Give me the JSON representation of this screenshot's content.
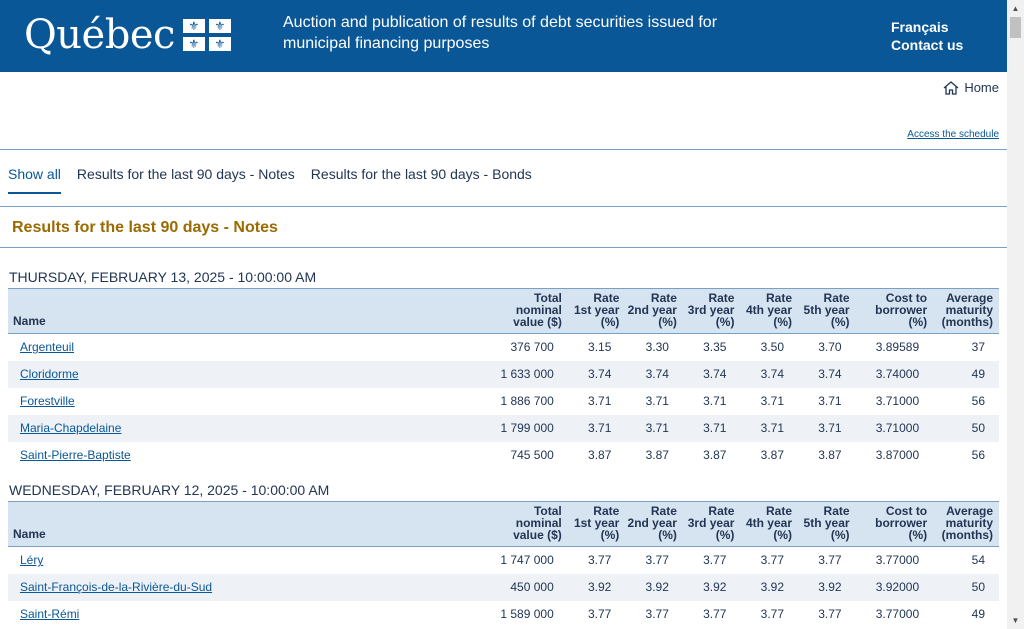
{
  "header": {
    "logo_text": "Québec",
    "title": "Auction and publication of results of debt securities issued for municipal financing purposes",
    "lang_link": "Français",
    "contact_link": "Contact us"
  },
  "nav": {
    "home_label": "Home",
    "schedule_link": "Access the schedule"
  },
  "tabs": [
    {
      "label": "Show all",
      "active": true
    },
    {
      "label": "Results for the last 90 days - Notes",
      "active": false
    },
    {
      "label": "Results for the last 90 days - Bonds",
      "active": false
    }
  ],
  "section_title": "Results for the last 90 days - Notes",
  "columns": {
    "name": "Name",
    "total": [
      "Total",
      "nominal",
      "value ($)"
    ],
    "rate1": [
      "Rate",
      "1st year",
      "(%)"
    ],
    "rate2": [
      "Rate",
      "2nd year",
      "(%)"
    ],
    "rate3": [
      "Rate",
      "3rd year",
      "(%)"
    ],
    "rate4": [
      "Rate",
      "4th year",
      "(%)"
    ],
    "rate5": [
      "Rate",
      "5th year",
      "(%)"
    ],
    "cost": [
      "Cost to",
      "borrower",
      "(%)"
    ],
    "maturity": [
      "Average",
      "maturity",
      "(months)"
    ]
  },
  "auctions": [
    {
      "date": "THURSDAY, FEBRUARY 13, 2025 - 10:00:00 AM",
      "rows": [
        [
          "Argenteuil",
          "376 700",
          "3.15",
          "3.30",
          "3.35",
          "3.50",
          "3.70",
          "3.89589",
          "37"
        ],
        [
          "Cloridorme",
          "1 633 000",
          "3.74",
          "3.74",
          "3.74",
          "3.74",
          "3.74",
          "3.74000",
          "49"
        ],
        [
          "Forestville",
          "1 886 700",
          "3.71",
          "3.71",
          "3.71",
          "3.71",
          "3.71",
          "3.71000",
          "56"
        ],
        [
          "Maria-Chapdelaine",
          "1 799 000",
          "3.71",
          "3.71",
          "3.71",
          "3.71",
          "3.71",
          "3.71000",
          "50"
        ],
        [
          "Saint-Pierre-Baptiste",
          "745 500",
          "3.87",
          "3.87",
          "3.87",
          "3.87",
          "3.87",
          "3.87000",
          "56"
        ]
      ]
    },
    {
      "date": "WEDNESDAY, FEBRUARY 12, 2025 - 10:00:00 AM",
      "rows": [
        [
          "Léry",
          "1 747 000",
          "3.77",
          "3.77",
          "3.77",
          "3.77",
          "3.77",
          "3.77000",
          "54"
        ],
        [
          "Saint-François-de-la-Rivière-du-Sud",
          "450 000",
          "3.92",
          "3.92",
          "3.92",
          "3.92",
          "3.92",
          "3.92000",
          "50"
        ],
        [
          "Saint-Rémi",
          "1 589 000",
          "3.77",
          "3.77",
          "3.77",
          "3.77",
          "3.77",
          "3.77000",
          "49"
        ]
      ]
    }
  ]
}
